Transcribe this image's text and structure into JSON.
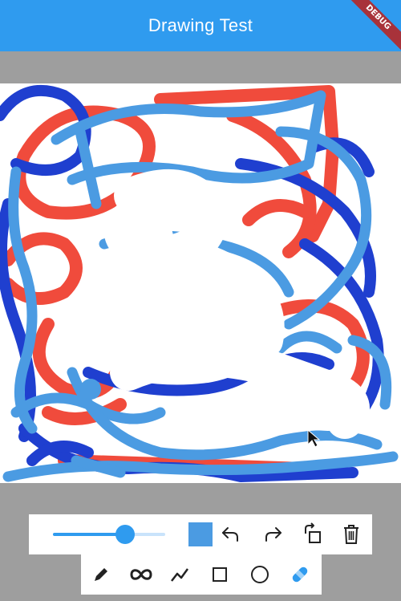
{
  "appbar": {
    "title": "Drawing Test",
    "debug_banner": "DEBUG"
  },
  "colors": {
    "appbar": "#2f9bef",
    "red_stroke": "#f04b3c",
    "dark_blue_stroke": "#1f3fcf",
    "light_blue_stroke": "#4b9be2",
    "selected_color": "#4b9be2"
  },
  "toolbar": {
    "stroke_width_fraction": 0.64,
    "selected_color": "#4b9be2",
    "actions": [
      "undo-icon",
      "redo-icon",
      "rotate-icon",
      "delete-icon"
    ],
    "tools": [
      "pencil-icon",
      "infinity-icon",
      "polyline-icon",
      "square-icon",
      "circle-icon",
      "eraser-icon"
    ],
    "active_tool": "eraser-icon"
  }
}
